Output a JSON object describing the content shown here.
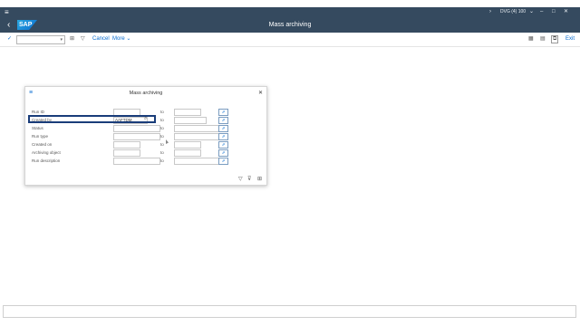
{
  "system_info": "DVG (4) 100",
  "window": {
    "title": "Mass archiving",
    "logo": "SAP"
  },
  "toolbar": {
    "cancel_label": "Cancel",
    "more_label": "More",
    "exit_label": "Exit"
  },
  "dialog": {
    "title": "Mass archiving",
    "to_label": "to",
    "rows": [
      {
        "label": "Run ID",
        "from": "",
        "to": ""
      },
      {
        "label": "Created by",
        "from": "AAFTDM",
        "to": ""
      },
      {
        "label": "Status",
        "from": "",
        "to": ""
      },
      {
        "label": "Run type",
        "from": "",
        "to": ""
      },
      {
        "label": "Created on",
        "from": "",
        "to": ""
      },
      {
        "label": "Archiving object",
        "from": "",
        "to": ""
      },
      {
        "label": "Run description",
        "from": "",
        "to": ""
      }
    ]
  },
  "icons": [
    "menu-icon",
    "back-icon",
    "checkmark-icon",
    "filter-icon",
    "calendar-icon",
    "layout-icon",
    "search-icon",
    "multiple-selection-icon",
    "close-icon"
  ]
}
